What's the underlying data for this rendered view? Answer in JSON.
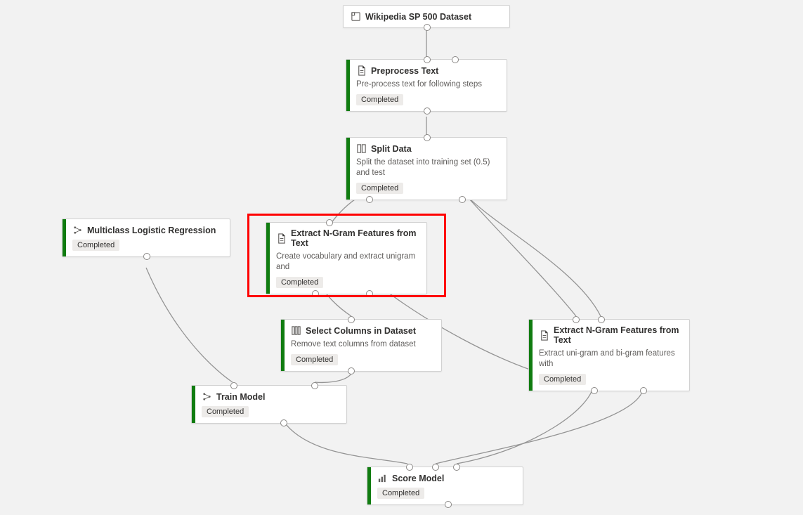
{
  "nodes": {
    "wikipedia": {
      "title": "Wikipedia SP 500 Dataset"
    },
    "preprocess": {
      "title": "Preprocess Text",
      "desc": "Pre-process text for following steps",
      "status": "Completed"
    },
    "split": {
      "title": "Split Data",
      "desc": "Split the dataset into training set (0.5) and test",
      "status": "Completed"
    },
    "logreg": {
      "title": "Multiclass Logistic Regression",
      "status": "Completed"
    },
    "ngram1": {
      "title": "Extract N-Gram Features from Text",
      "desc": "Create vocabulary and extract unigram and",
      "status": "Completed"
    },
    "selectcols": {
      "title": "Select Columns in Dataset",
      "desc": "Remove text columns from dataset",
      "status": "Completed"
    },
    "ngram2": {
      "title": "Extract N-Gram Features from Text",
      "desc": "Extract uni-gram and bi-gram features with",
      "status": "Completed"
    },
    "train": {
      "title": "Train Model",
      "status": "Completed"
    },
    "score": {
      "title": "Score Model",
      "status": "Completed"
    }
  }
}
